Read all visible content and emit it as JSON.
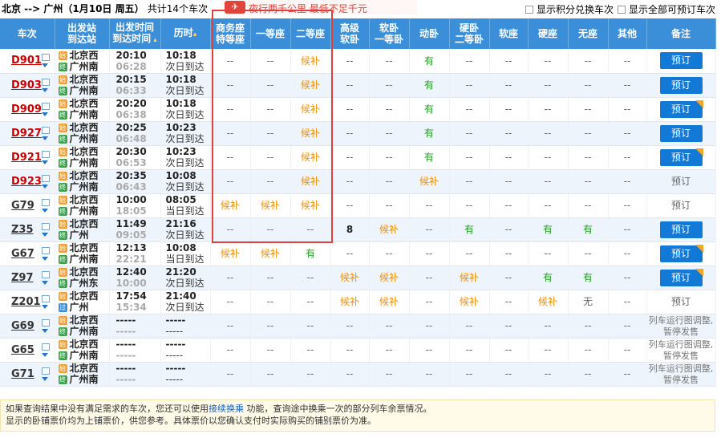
{
  "header": {
    "route": "北京 --> 广州（1月10日 周五）",
    "count": "共计14个车次",
    "promo_logo": "✈",
    "promo_text": "夜行两千公里 最低不足千元",
    "option_points": "显示积分兑换车次",
    "option_all": "显示全部可预订车次"
  },
  "columns": [
    "车次",
    "出发站\n到达站",
    "出发时间\n到达时间",
    "历时",
    "商务座\n特等座",
    "一等座",
    "二等座",
    "高级\n软卧",
    "软卧\n一等卧",
    "动卧",
    "硬卧\n二等卧",
    "软座",
    "硬座",
    "无座",
    "其他",
    "备注"
  ],
  "colors": {
    "header_bg": "#3b8fd8",
    "wait": "#f09000",
    "has": "#2a9a2a",
    "book": "#1379d6",
    "highlight": "#e04040"
  },
  "rows": [
    {
      "no": "D901",
      "red": true,
      "from": "北京西",
      "to": "广州南",
      "from_badge": "始",
      "to_badge": "终",
      "dep": "20:10",
      "arr": "06:28",
      "dur": "10:18",
      "day": "次日到达",
      "seats": [
        "--",
        "--",
        "候补",
        "--",
        "--",
        "有",
        "--",
        "--",
        "--",
        "--",
        "--"
      ],
      "action": "预订",
      "action_on": true,
      "corner": false
    },
    {
      "no": "D903",
      "red": true,
      "from": "北京西",
      "to": "广州南",
      "from_badge": "始",
      "to_badge": "终",
      "dep": "20:15",
      "arr": "06:33",
      "dur": "10:18",
      "day": "次日到达",
      "seats": [
        "--",
        "--",
        "候补",
        "--",
        "--",
        "有",
        "--",
        "--",
        "--",
        "--",
        "--"
      ],
      "action": "预订",
      "action_on": true,
      "corner": false
    },
    {
      "no": "D909",
      "red": true,
      "from": "北京西",
      "to": "广州南",
      "from_badge": "始",
      "to_badge": "终",
      "dep": "20:20",
      "arr": "06:38",
      "dur": "10:18",
      "day": "次日到达",
      "seats": [
        "--",
        "--",
        "候补",
        "--",
        "--",
        "有",
        "--",
        "--",
        "--",
        "--",
        "--"
      ],
      "action": "预订",
      "action_on": true,
      "corner": true
    },
    {
      "no": "D927",
      "red": true,
      "from": "北京西",
      "to": "广州南",
      "from_badge": "始",
      "to_badge": "终",
      "dep": "20:25",
      "arr": "06:48",
      "dur": "10:23",
      "day": "次日到达",
      "seats": [
        "--",
        "--",
        "候补",
        "--",
        "--",
        "有",
        "--",
        "--",
        "--",
        "--",
        "--"
      ],
      "action": "预订",
      "action_on": true,
      "corner": false
    },
    {
      "no": "D921",
      "red": true,
      "from": "北京西",
      "to": "广州南",
      "from_badge": "始",
      "to_badge": "终",
      "dep": "20:30",
      "arr": "06:53",
      "dur": "10:23",
      "day": "次日到达",
      "seats": [
        "--",
        "--",
        "候补",
        "--",
        "--",
        "有",
        "--",
        "--",
        "--",
        "--",
        "--"
      ],
      "action": "预订",
      "action_on": true,
      "corner": true
    },
    {
      "no": "D923",
      "red": true,
      "from": "北京西",
      "to": "广州南",
      "from_badge": "始",
      "to_badge": "终",
      "dep": "20:35",
      "arr": "06:43",
      "dur": "10:08",
      "day": "次日到达",
      "seats": [
        "--",
        "--",
        "候补",
        "--",
        "--",
        "候补",
        "--",
        "--",
        "--",
        "--",
        "--"
      ],
      "action": "预订",
      "action_on": false,
      "corner": false
    },
    {
      "no": "G79",
      "red": false,
      "from": "北京西",
      "to": "广州南",
      "from_badge": "始",
      "to_badge": "终",
      "dep": "10:00",
      "arr": "18:05",
      "dur": "08:05",
      "day": "当日到达",
      "seats": [
        "候补",
        "候补",
        "候补",
        "--",
        "--",
        "--",
        "--",
        "--",
        "--",
        "--",
        "--"
      ],
      "action": "预订",
      "action_on": false,
      "corner": false
    },
    {
      "no": "Z35",
      "red": false,
      "from": "北京西",
      "to": "广州",
      "from_badge": "始",
      "to_badge": "终",
      "dep": "11:49",
      "arr": "09:05",
      "dur": "21:16",
      "day": "次日到达",
      "seats": [
        "--",
        "--",
        "--",
        "8",
        "候补",
        "--",
        "有",
        "--",
        "有",
        "有",
        "--"
      ],
      "action": "预订",
      "action_on": true,
      "corner": false
    },
    {
      "no": "G67",
      "red": false,
      "from": "北京西",
      "to": "广州南",
      "from_badge": "始",
      "to_badge": "终",
      "dep": "12:13",
      "arr": "22:21",
      "dur": "10:08",
      "day": "当日到达",
      "seats": [
        "候补",
        "候补",
        "有",
        "--",
        "--",
        "--",
        "--",
        "--",
        "--",
        "--",
        "--"
      ],
      "action": "预订",
      "action_on": true,
      "corner": true
    },
    {
      "no": "Z97",
      "red": false,
      "from": "北京西",
      "to": "广州东",
      "from_badge": "始",
      "to_badge": "终",
      "dep": "12:40",
      "arr": "10:00",
      "dur": "21:20",
      "day": "次日到达",
      "seats": [
        "--",
        "--",
        "--",
        "候补",
        "候补",
        "--",
        "候补",
        "--",
        "有",
        "有",
        "--"
      ],
      "action": "预订",
      "action_on": true,
      "corner": true
    },
    {
      "no": "Z201",
      "red": false,
      "from": "北京西",
      "to": "广州",
      "from_badge": "始",
      "to_badge": "过",
      "dep": "17:54",
      "arr": "15:34",
      "dur": "21:40",
      "day": "次日到达",
      "seats": [
        "--",
        "--",
        "--",
        "候补",
        "候补",
        "--",
        "候补",
        "--",
        "候补",
        "无",
        "--"
      ],
      "action": "预订",
      "action_on": false,
      "corner": false
    },
    {
      "no": "G69",
      "red": false,
      "from": "北京西",
      "to": "广州南",
      "from_badge": "始",
      "to_badge": "终",
      "dep": "-----",
      "arr": "-----",
      "dur": "-----",
      "day": "-----",
      "seats": [
        "--",
        "--",
        "--",
        "--",
        "--",
        "--",
        "--",
        "--",
        "--",
        "--",
        "--"
      ],
      "action": "列车运行图调整,暂停发售",
      "action_on": false,
      "corner": false
    },
    {
      "no": "G65",
      "red": false,
      "from": "北京西",
      "to": "广州南",
      "from_badge": "始",
      "to_badge": "终",
      "dep": "-----",
      "arr": "-----",
      "dur": "-----",
      "day": "-----",
      "seats": [
        "--",
        "--",
        "--",
        "--",
        "--",
        "--",
        "--",
        "--",
        "--",
        "--",
        "--"
      ],
      "action": "列车运行图调整,暂停发售",
      "action_on": false,
      "corner": false
    },
    {
      "no": "G71",
      "red": false,
      "from": "北京西",
      "to": "广州南",
      "from_badge": "始",
      "to_badge": "终",
      "dep": "-----",
      "arr": "-----",
      "dur": "-----",
      "day": "-----",
      "seats": [
        "--",
        "--",
        "--",
        "--",
        "--",
        "--",
        "--",
        "--",
        "--",
        "--",
        "--"
      ],
      "action": "列车运行图调整,暂停发售",
      "action_on": false,
      "corner": false
    }
  ],
  "footer": {
    "line1_pre": "如果查询结果中没有满足需求的车次，您还可以使用",
    "line1_link": "接续换乘",
    "line1_post": "功能，查询途中换乘一次的部分列车余票情况。",
    "line2": "显示的卧铺票价均为上铺票价，供您参考。具体票价以您确认支付时实际购买的铺别票价为准。"
  }
}
